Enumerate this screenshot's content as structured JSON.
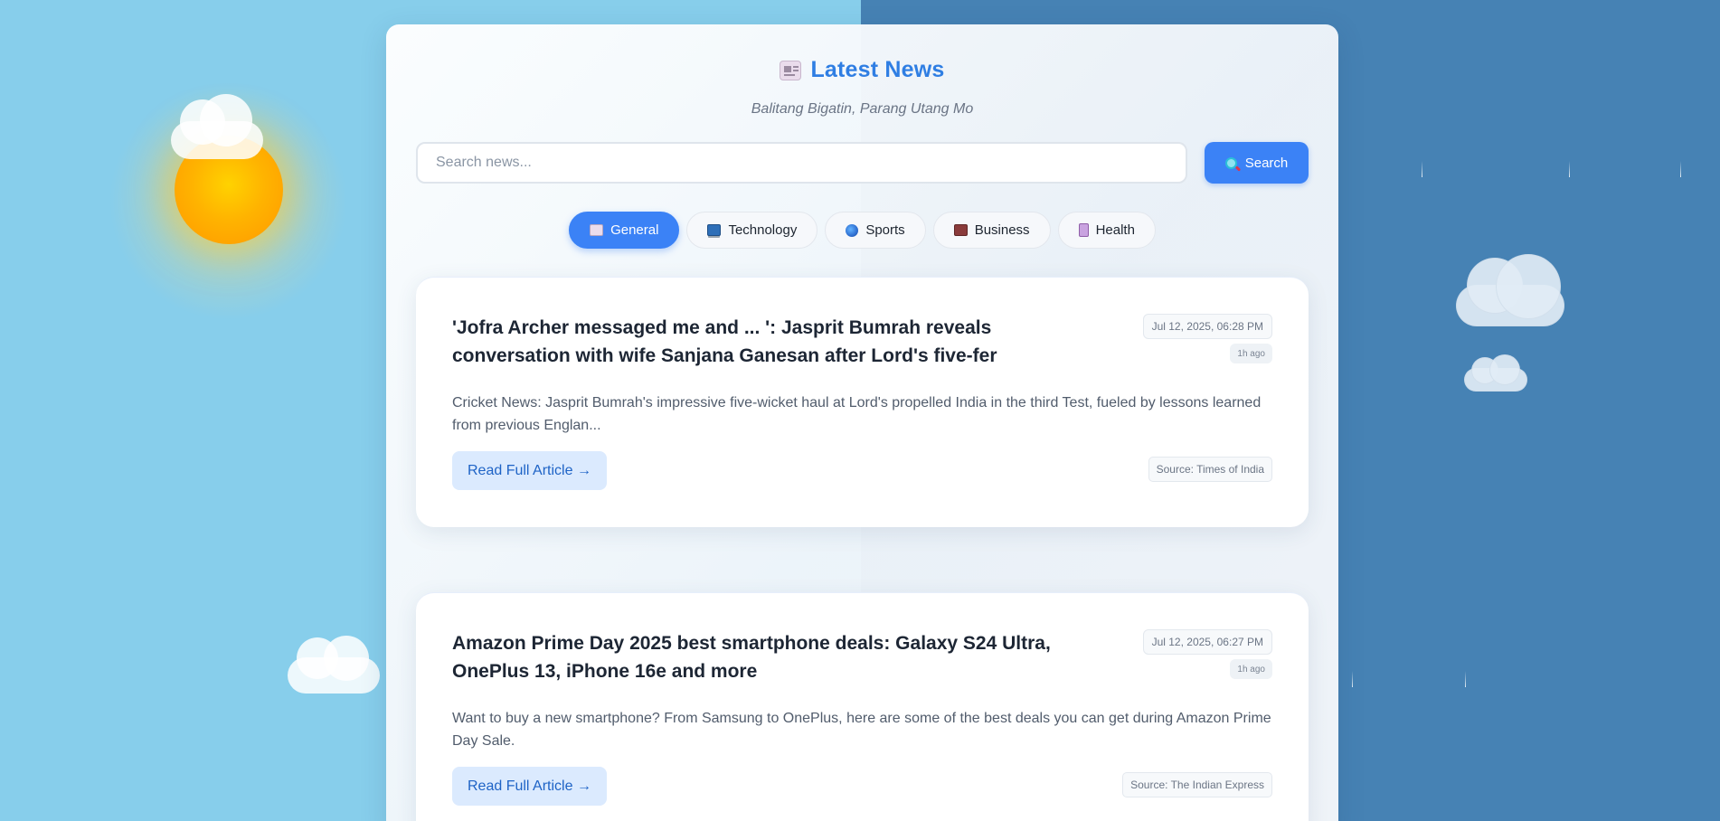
{
  "header": {
    "title": "Latest News",
    "subtitle": "Balitang Bigatin, Parang Utang Mo",
    "title_icon": "newspaper-icon"
  },
  "search": {
    "placeholder": "Search news...",
    "value": "",
    "button_label": "Search",
    "button_icon": "magnifier-icon"
  },
  "tabs": [
    {
      "label": "General",
      "icon": "newspaper-icon",
      "active": true
    },
    {
      "label": "Technology",
      "icon": "laptop-icon",
      "active": false
    },
    {
      "label": "Sports",
      "icon": "globe-icon",
      "active": false
    },
    {
      "label": "Business",
      "icon": "briefcase-icon",
      "active": false
    },
    {
      "label": "Health",
      "icon": "book-icon",
      "active": false
    }
  ],
  "articles": [
    {
      "title": "'Jofra Archer messaged me and ... ': Jasprit Bumrah reveals conversation with wife Sanjana Ganesan after Lord's five-fer",
      "date": "Jul 12, 2025, 06:28 PM",
      "ago": "1h ago",
      "description": "Cricket News: Jasprit Bumrah's impressive five-wicket haul at Lord's propelled India in the third Test, fueled by lessons learned from previous Englan...",
      "read_label": "Read Full Article →",
      "source": "Source: Times of India"
    },
    {
      "title": "Amazon Prime Day 2025 best smartphone deals: Galaxy S24 Ultra, OnePlus 13, iPhone 16e and more",
      "date": "Jul 12, 2025, 06:27 PM",
      "ago": "1h ago",
      "description": "Want to buy a new smartphone? From Samsung to OnePlus, here are some of the best deals you can get during Amazon Prime Day Sale.",
      "read_label": "Read Full Article →",
      "source": "Source: The Indian Express"
    }
  ],
  "colors": {
    "accent": "#3b82f6",
    "title": "#2f7ee3",
    "sky_left": "#87ceeb",
    "sky_right": "#4682b4"
  }
}
